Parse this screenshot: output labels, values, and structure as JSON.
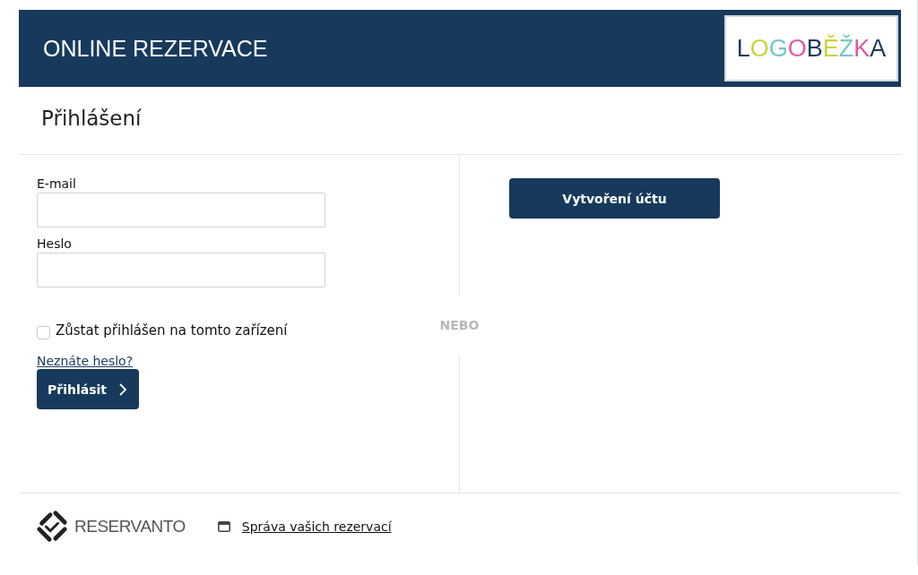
{
  "header": {
    "title": "ONLINE REZERVACE",
    "logo": "LOGOBĚŽKA"
  },
  "page_title": "Přihlášení",
  "login": {
    "fields": [
      {
        "label": "E-mail"
      },
      {
        "label": "Heslo"
      }
    ],
    "remember": {
      "label": "Zůstat přihlášen na tomto zařízení",
      "checked": false
    },
    "forgot_link": "Neznáte heslo?",
    "submit": "Přihlásit"
  },
  "separator": "NEBO",
  "create_account": "Vytvoření účtu",
  "footer": {
    "brand": "RESERVANTO",
    "link": "Správa vašich rezervací"
  }
}
